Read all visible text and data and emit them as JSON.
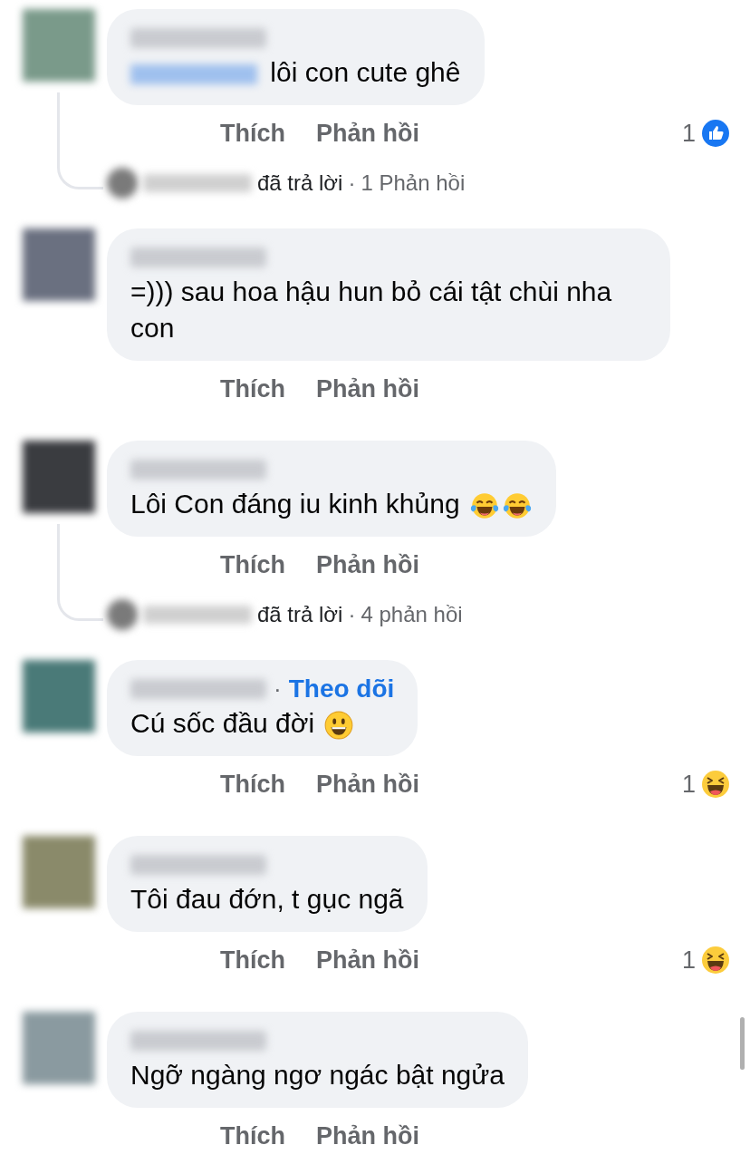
{
  "comments": [
    {
      "mention": true,
      "text": "lôi con cute ghê",
      "actions": [
        "Thích",
        "Phản hồi"
      ],
      "reaction": {
        "count": "1",
        "kind": "like"
      },
      "replies": {
        "verb": "đã trả lời",
        "separator": "·",
        "count": "1 Phản hồi"
      }
    },
    {
      "mention": false,
      "text": "=))) sau hoa hậu hun bỏ cái tật chùi nha con",
      "actions": [
        "Thích",
        "Phản hồi"
      ]
    },
    {
      "mention": false,
      "text": "Lôi Con đáng iu kinh khủng",
      "emojis": [
        {
          "kind": "laugh-tears"
        },
        {
          "kind": "laugh-tears"
        }
      ],
      "actions": [
        "Thích",
        "Phản hồi"
      ],
      "replies": {
        "verb": "đã trả lời",
        "separator": "·",
        "count": "4 phản hồi"
      }
    },
    {
      "mention": false,
      "follow": {
        "separator": "·",
        "label": "Theo dõi"
      },
      "text": "Cú sốc đầu đời",
      "emojis": [
        {
          "kind": "smile"
        }
      ],
      "actions": [
        "Thích",
        "Phản hồi"
      ],
      "reaction": {
        "count": "1",
        "kind": "haha"
      }
    },
    {
      "mention": false,
      "text": "Tôi đau đớn, t gục ngã",
      "actions": [
        "Thích",
        "Phản hồi"
      ],
      "reaction": {
        "count": "1",
        "kind": "haha"
      }
    },
    {
      "mention": false,
      "text": "Ngỡ ngàng ngơ ngác bật ngửa",
      "actions": [
        "Thích",
        "Phản hồi"
      ]
    }
  ]
}
